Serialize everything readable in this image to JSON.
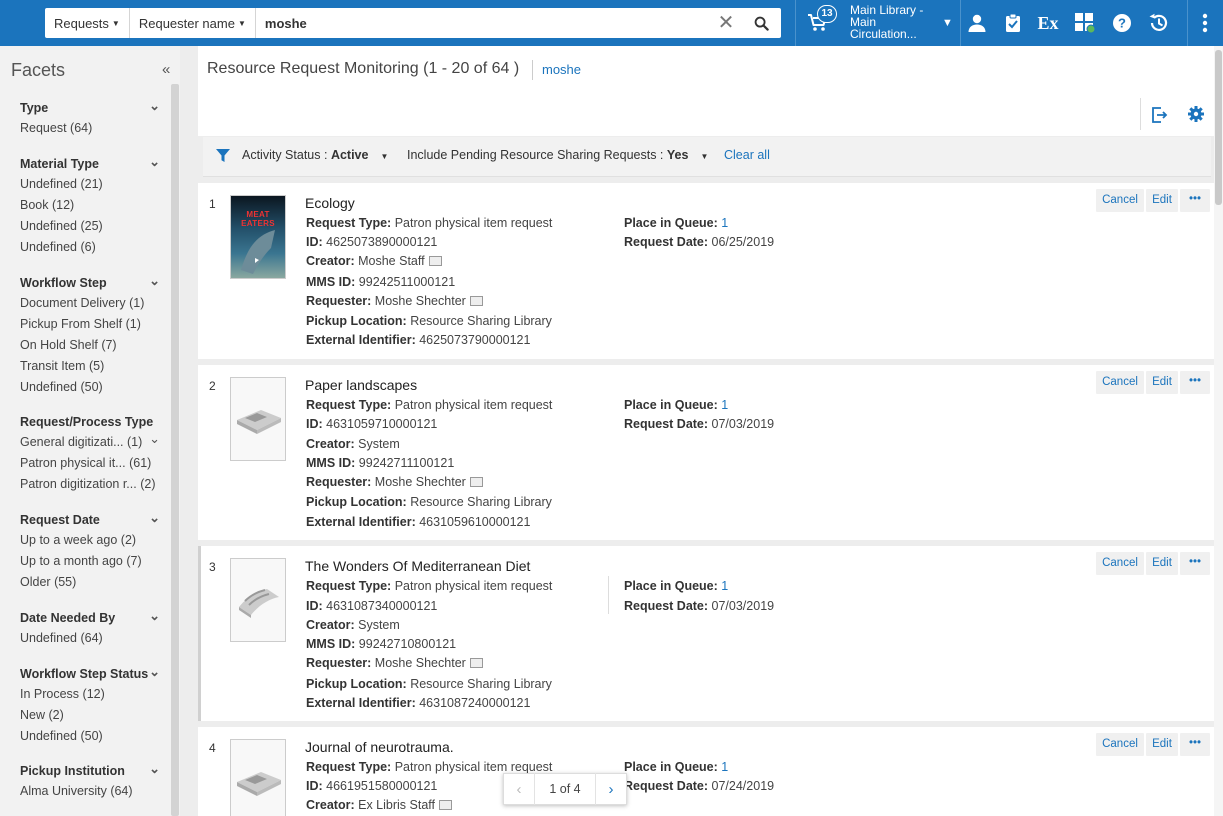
{
  "search": {
    "scope": "Requests",
    "field": "Requester name",
    "value": "moshe"
  },
  "topbar": {
    "cart_count": "13",
    "library_line1": "Main Library -",
    "library_line2": "Main",
    "library_line3": "Circulation..."
  },
  "facets": {
    "title": "Facets",
    "groups": [
      {
        "title": "Type",
        "items": [
          {
            "label": "Request",
            "count": "(64)"
          }
        ]
      },
      {
        "title": "Material Type",
        "items": [
          {
            "label": "Undefined",
            "count": "(21)"
          },
          {
            "label": "Book",
            "count": "(12)"
          },
          {
            "label": "Undefined",
            "count": "(25)"
          },
          {
            "label": "Undefined",
            "count": "(6)"
          }
        ]
      },
      {
        "title": "Workflow Step",
        "items": [
          {
            "label": "Document Delivery",
            "count": "(1)"
          },
          {
            "label": "Pickup From Shelf",
            "count": "(1)"
          },
          {
            "label": "On Hold Shelf",
            "count": "(7)"
          },
          {
            "label": "Transit Item",
            "count": "(5)"
          },
          {
            "label": "Undefined",
            "count": "(50)"
          }
        ]
      },
      {
        "title": "Request/Process Type",
        "items": [
          {
            "label": "General digitizati...",
            "count": "(1)"
          },
          {
            "label": "Patron physical it...",
            "count": "(61)"
          },
          {
            "label": "Patron digitization r...",
            "count": "(2)"
          }
        ]
      },
      {
        "title": "Request Date",
        "items": [
          {
            "label": "Up to a week ago",
            "count": "(2)"
          },
          {
            "label": "Up to a month ago",
            "count": "(7)"
          },
          {
            "label": "Older",
            "count": "(55)"
          }
        ]
      },
      {
        "title": "Date Needed By",
        "items": [
          {
            "label": "Undefined",
            "count": "(64)"
          }
        ]
      },
      {
        "title": "Workflow Step Status",
        "items": [
          {
            "label": "In Process",
            "count": "(12)"
          },
          {
            "label": "New",
            "count": "(2)"
          },
          {
            "label": "Undefined",
            "count": "(50)"
          }
        ]
      },
      {
        "title": "Pickup Institution",
        "items": [
          {
            "label": "Alma University",
            "count": "(64)"
          }
        ]
      }
    ]
  },
  "page": {
    "title": "Resource Request Monitoring (1 - 20 of 64 )",
    "search_tag": "moshe"
  },
  "filters": {
    "status_label": "Activity Status :",
    "status_value": "Active",
    "pending_label": "Include Pending Resource Sharing Requests :",
    "pending_value": "Yes",
    "clear": "Clear all"
  },
  "labels": {
    "request_type": "Request Type:",
    "id": "ID:",
    "creator": "Creator:",
    "mms": "MMS ID:",
    "requester": "Requester:",
    "pickup": "Pickup Location:",
    "external": "External Identifier:",
    "queue": "Place in Queue:",
    "date": "Request Date:",
    "cancel": "Cancel",
    "edit": "Edit",
    "more": "•••"
  },
  "records": [
    {
      "num": "1",
      "title": "Ecology",
      "thumb_text": "MEAT EATERS",
      "request_type": "Patron physical item request",
      "id": "4625073890000121",
      "creator": "Moshe Staff",
      "mms": "99242511000121",
      "requester": "Moshe Shechter",
      "pickup": "Resource Sharing Library",
      "external": "4625073790000121",
      "queue": "1",
      "date": "06/25/2019"
    },
    {
      "num": "2",
      "title": "Paper landscapes",
      "request_type": "Patron physical item request",
      "id": "4631059710000121",
      "creator": "System",
      "mms": "99242711100121",
      "requester": "Moshe Shechter",
      "pickup": "Resource Sharing Library",
      "external": "4631059610000121",
      "queue": "1",
      "date": "07/03/2019"
    },
    {
      "num": "3",
      "title": "The Wonders Of Mediterranean Diet",
      "request_type": "Patron physical item request",
      "id": "4631087340000121",
      "creator": "System",
      "mms": "99242710800121",
      "requester": "Moshe Shechter",
      "pickup": "Resource Sharing Library",
      "external": "4631087240000121",
      "queue": "1",
      "date": "07/03/2019"
    },
    {
      "num": "4",
      "title": "Journal of neurotrauma.",
      "request_type": "Patron physical item request",
      "id": "4661951580000121",
      "creator": "Ex Libris Staff",
      "queue": "1",
      "date": "07/24/2019"
    }
  ],
  "pager": {
    "text": "1 of 4"
  },
  "colors": {
    "brand": "#1b74bd",
    "link": "#1b74bd"
  }
}
